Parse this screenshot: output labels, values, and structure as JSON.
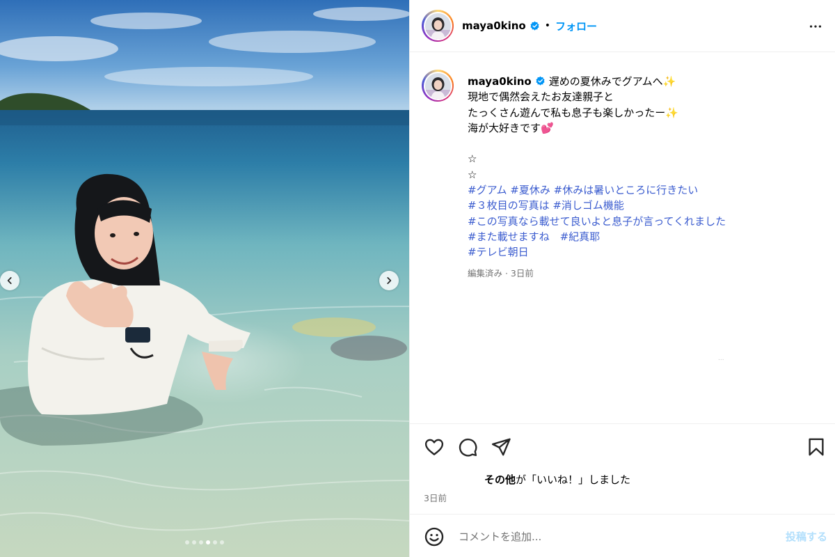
{
  "colors": {
    "link": "#0095f6",
    "hashtag": "#3b5ccf",
    "muted": "#737373",
    "post_disabled": "#b2dffc"
  },
  "media": {
    "prev_icon": "chevron-left-icon",
    "next_icon": "chevron-right-icon",
    "slide_count": 6,
    "active_slide": 4
  },
  "header": {
    "username": "maya0kino",
    "separator": "•",
    "follow_label": "フォロー",
    "more_icon": "more-dots-icon"
  },
  "caption": {
    "username": "maya0kino",
    "lines": [
      "遅めの夏休みでグアムへ✨",
      "現地で偶然会えたお友達親子と",
      "たっくさん遊んで私も息子も楽しかったー✨",
      "海が大好きです💕",
      "",
      "☆",
      "☆"
    ],
    "hashtag_lines": [
      "#グアム #夏休み #休みは暑いところに行きたい",
      "#３枚目の写真は #消しゴム機能",
      "#この写真なら載せて良いよと息子が言ってくれました",
      "#また載せますね　#紀真耶",
      "#テレビ朝日"
    ],
    "meta": "編集済み · 3日前",
    "faint_mark": "..."
  },
  "actions": {
    "like_icon": "heart-icon",
    "comment_icon": "comment-icon",
    "share_icon": "share-icon",
    "save_icon": "bookmark-icon",
    "likes_bold": "その他",
    "likes_rest": "が「いいね！」しました",
    "date": "3日前"
  },
  "comment": {
    "emoji_icon": "emoji-icon",
    "placeholder": "コメントを追加...",
    "post_label": "投稿する"
  }
}
